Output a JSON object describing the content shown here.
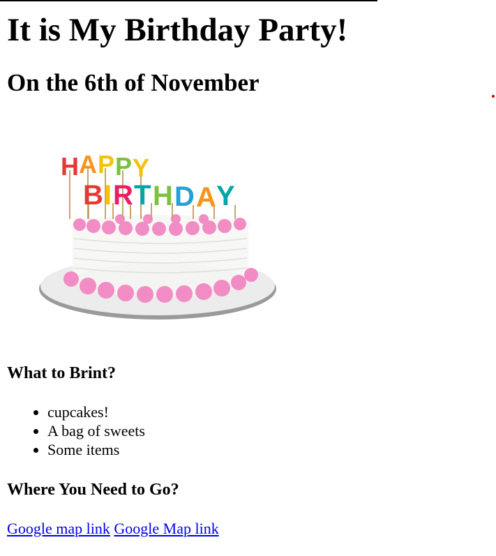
{
  "header": {
    "title": "It is My Birthday Party!",
    "subtitle": "On the 6th of November"
  },
  "image": {
    "alt": "Happy Birthday cake",
    "candle_text": [
      "HAPPY",
      "BIRTHDAY"
    ],
    "colors": {
      "frosting": "#f7f7f5",
      "icing_pink": "#f28cc4",
      "board": "#ececec",
      "candles": [
        "#e53935",
        "#f7941d",
        "#f4c20d",
        "#7cc142",
        "#00a6a6",
        "#2a9fd6",
        "#8e44ad",
        "#e91e63"
      ]
    }
  },
  "bring": {
    "heading": "What to Brint?",
    "items": [
      "cupcakes!",
      "A bag of sweets",
      "Some items"
    ]
  },
  "where": {
    "heading": "Where You Need to Go?",
    "links": [
      "Google map link",
      "Google Map link"
    ]
  },
  "colors": {
    "link": "#0000ee",
    "dot": "#d40000"
  }
}
